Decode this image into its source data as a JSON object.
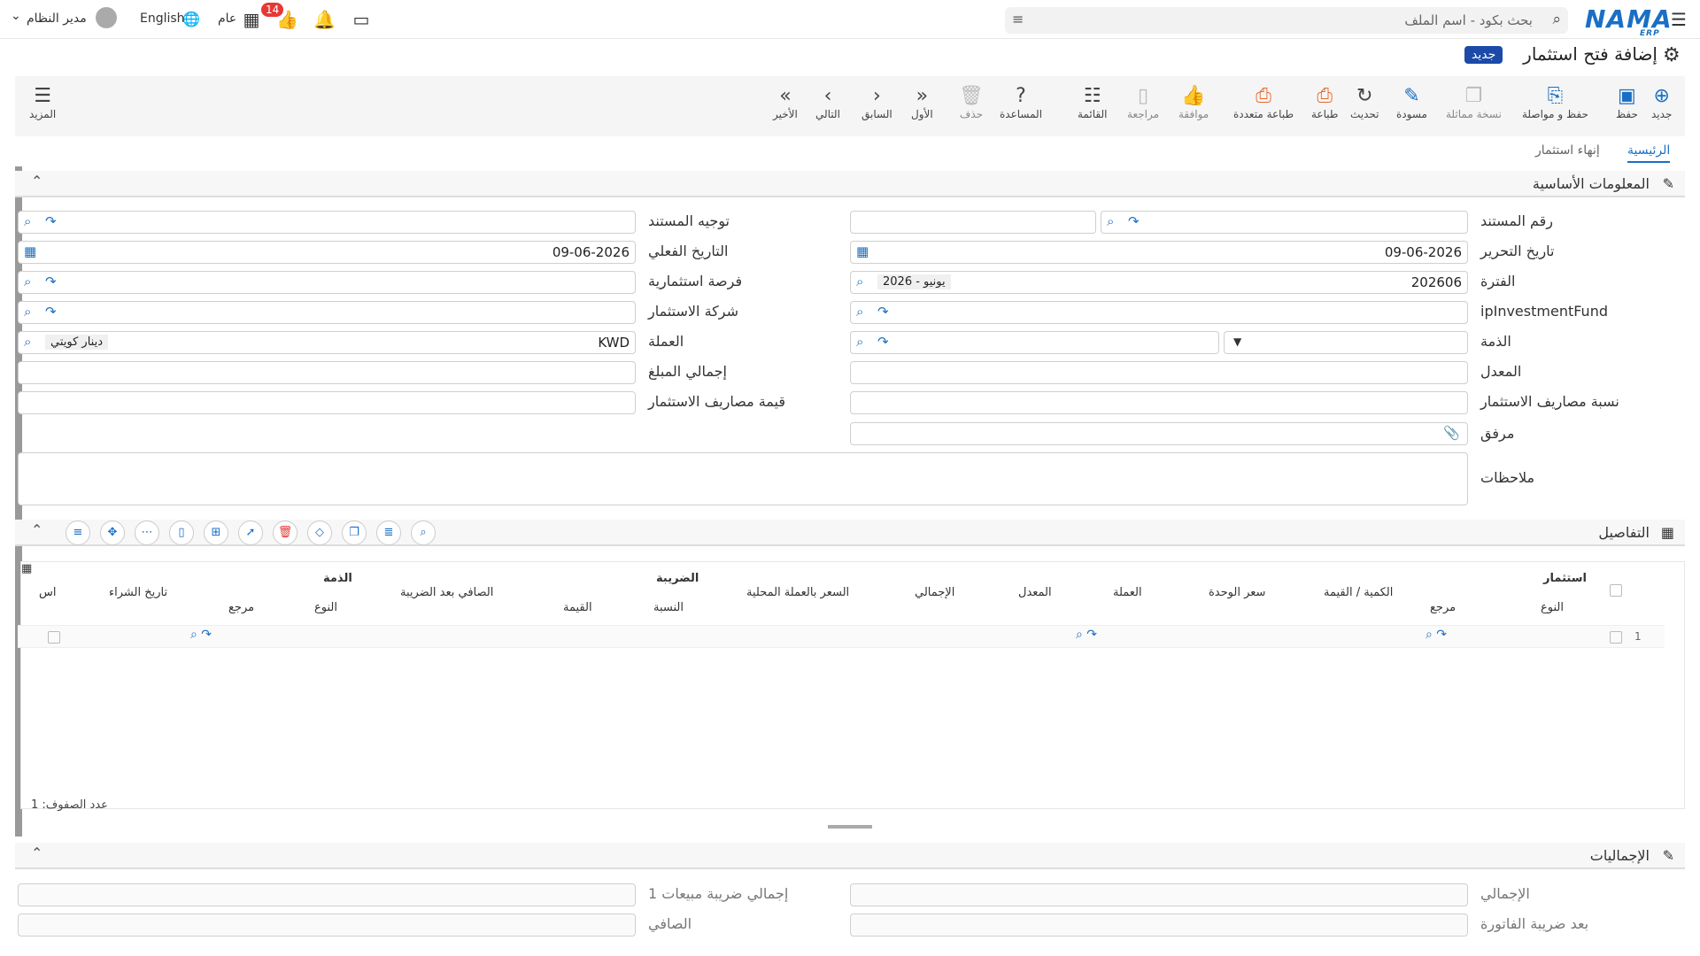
{
  "topbar": {
    "search_placeholder": "بحث بكود - اسم الملف",
    "user_name": "مدير النظام",
    "language": "English",
    "public_label": "عام",
    "notification_count": "14",
    "logo_text": "NAMA",
    "logo_sub": "ERP"
  },
  "page": {
    "title": "إضافة فتح استثمار",
    "status_badge": "جديد"
  },
  "toolbar": {
    "new": "جديد",
    "save": "حفظ",
    "save_continue": "حفظ و مواصلة",
    "copy_similar": "نسخة مماثلة",
    "draft": "مسودة",
    "refresh": "تحديث",
    "print": "طباعة",
    "multi_print": "طباعة متعددة",
    "approve": "موافقة",
    "review": "مراجعة",
    "list": "القائمة",
    "help": "المساعدة",
    "delete": "حذف",
    "first": "الأول",
    "previous": "السابق",
    "next": "التالي",
    "last": "الأخير",
    "more": "المزيد"
  },
  "tabs": {
    "main": "الرئيسية",
    "end_investment": "إنهاء استثمار"
  },
  "basic_info": {
    "title": "المعلومات الأساسية",
    "doc_number_label": "رقم المستند",
    "doc_direction_label": "توجيه المستند",
    "edit_date_label": "تاريخ التحرير",
    "edit_date_value": "09-06-2026",
    "actual_date_label": "التاريخ الفعلي",
    "actual_date_value": "09-06-2026",
    "period_label": "الفترة",
    "period_value": "202606",
    "period_chip": "2026 - يونيو",
    "opportunity_label": "فرصة استثمارية",
    "fund_label": "ipInvestmentFund",
    "company_label": "شركة الاستثمار",
    "liability_label": "الذمة",
    "currency_label": "العملة",
    "currency_value": "KWD",
    "currency_chip": "دينار كويتي",
    "rate_label": "المعدل",
    "total_amount_label": "إجمالي المبلغ",
    "expense_ratio_label": "نسبة مصاريف الاستثمار",
    "expense_value_label": "قيمة مصاريف الاستثمار",
    "attachment_label": "مرفق",
    "notes_label": "ملاحظات"
  },
  "details": {
    "title": "التفاصيل",
    "group_investment": "استثمار",
    "group_tax": "الضريبة",
    "group_liability": "الذمة",
    "columns": {
      "type": "النوع",
      "reference": "مرجع",
      "qty_value": "الكمية / القيمة",
      "unit_price": "سعر الوحدة",
      "currency": "العملة",
      "rate": "المعدل",
      "total": "الإجمالي",
      "local_price": "السعر بالعملة المحلية",
      "tax_ratio": "النسبة",
      "tax_value": "القيمة",
      "net_after_tax": "الصافي بعد الضريبة",
      "liab_type": "النوع",
      "liab_reference": "مرجع",
      "purchase_date": "تاريخ الشراء",
      "cut_col": "اس"
    },
    "row_number": "1",
    "row_count": "عدد الصفوف: 1"
  },
  "totals": {
    "title": "الإجماليات",
    "total_label": "الإجمالي",
    "after_tax_label": "بعد ضريبة الفاتورة",
    "sales_tax_label": "إجمالي ضريبة مبيعات 1",
    "net_label": "الصافي"
  }
}
